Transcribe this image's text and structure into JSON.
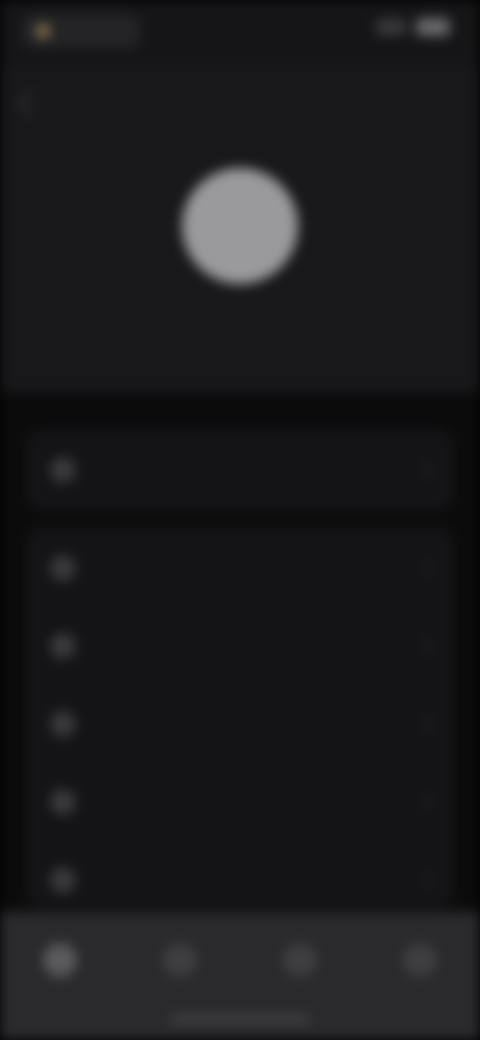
{
  "status_bar": {
    "left_text": "",
    "right_text": ""
  },
  "header": {
    "title": "",
    "back_icon": "chevron-left-icon"
  },
  "profile": {
    "name": "",
    "subtitle": "",
    "avatar_icon": "avatar-placeholder"
  },
  "primary_card": {
    "label": "",
    "icon": "star-icon"
  },
  "menu": {
    "items": [
      {
        "label": "",
        "icon": "gear-icon"
      },
      {
        "label": "",
        "icon": "bell-icon"
      },
      {
        "label": "",
        "icon": "lock-icon"
      },
      {
        "label": "",
        "icon": "help-icon"
      },
      {
        "label": "",
        "icon": "logout-icon"
      }
    ]
  },
  "bottom_nav": {
    "items": [
      {
        "label": "",
        "icon": "home-icon"
      },
      {
        "label": "",
        "icon": "search-icon"
      },
      {
        "label": "",
        "icon": "chat-icon"
      },
      {
        "label": "",
        "icon": "profile-icon"
      }
    ]
  },
  "colors": {
    "background": "#0b0b0c",
    "header": "#18181a",
    "card": "#141416",
    "nav": "#2a2a2c",
    "accent": "#8f7a52"
  }
}
